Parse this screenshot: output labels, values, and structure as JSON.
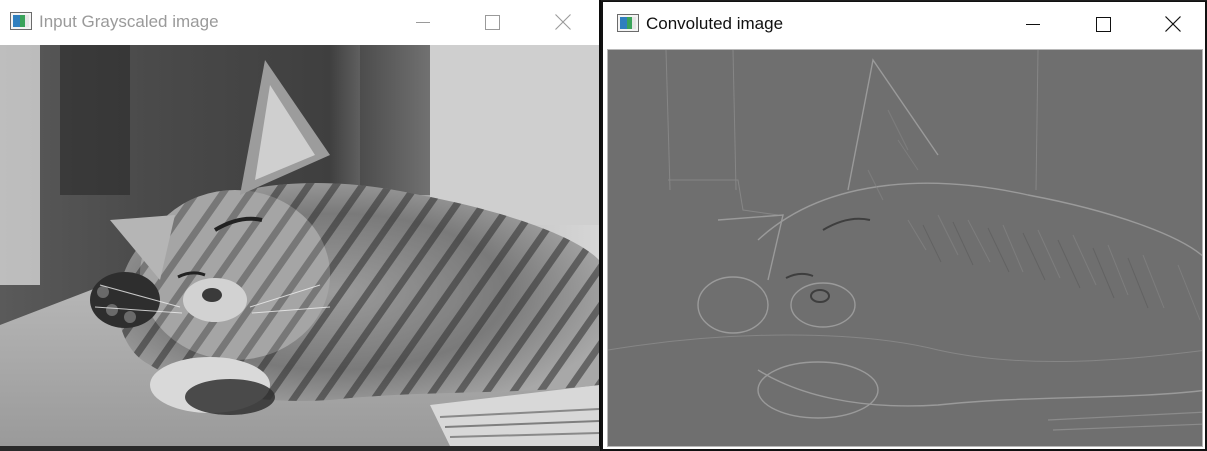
{
  "windows": {
    "input": {
      "title": "Input Grayscaled image",
      "active": false,
      "icon": "opencv-window-icon",
      "controls": [
        "minimize-icon",
        "maximize-icon",
        "close-icon"
      ]
    },
    "convoluted": {
      "title": "Convoluted image",
      "active": true,
      "icon": "opencv-window-icon",
      "controls": [
        "minimize-icon",
        "maximize-icon",
        "close-icon"
      ]
    }
  },
  "colors": {
    "inactive_title": "#9a9a9a",
    "active_title": "#111111",
    "grayscale_background": "#c9c9c9",
    "convolved_background": "#6f6f6f"
  }
}
